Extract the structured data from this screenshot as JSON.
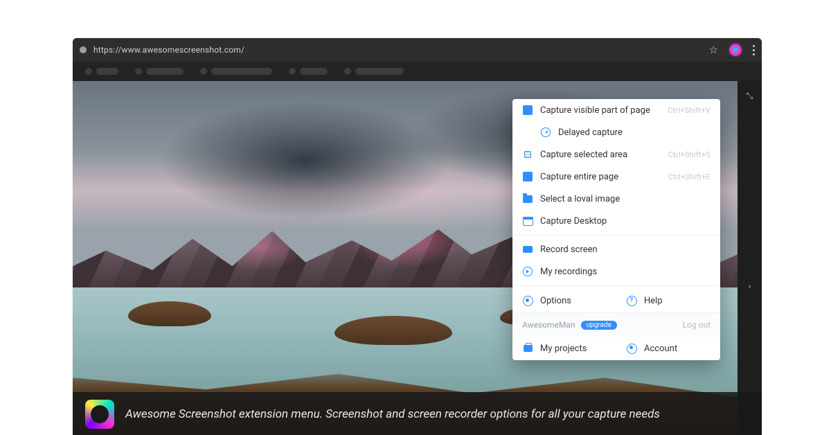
{
  "addressbar": {
    "url": "https://www.awesomescreenshot.com/"
  },
  "popup": {
    "items": [
      {
        "icon": "square-fill",
        "label": "Capture visible part of page",
        "shortcut": "Ctrl+Shift+V"
      },
      {
        "icon": "timer",
        "label": "Delayed capture",
        "indent": true
      },
      {
        "icon": "square-sm",
        "label": "Capture selected area",
        "shortcut": "Ctrl+Shift+S"
      },
      {
        "icon": "square-fill",
        "label": "Capture entire page",
        "shortcut": "Ctrl+Shift+E"
      },
      {
        "icon": "folder",
        "label": "Select a loval image"
      },
      {
        "icon": "window",
        "label": "Capture Desktop"
      }
    ],
    "record": [
      {
        "icon": "cam",
        "label": "Record screen"
      },
      {
        "icon": "play",
        "label": "My recordings"
      }
    ],
    "settings": {
      "options": "Options",
      "help": "Help"
    },
    "user": {
      "name": "AwesomeMan",
      "badge": "upgrade",
      "logout": "Log out",
      "projects": "My projects",
      "account": "Account"
    }
  },
  "caption": {
    "text": "Awesome Screenshot extension menu.  Screenshot and screen recorder options for all your capture needs"
  }
}
